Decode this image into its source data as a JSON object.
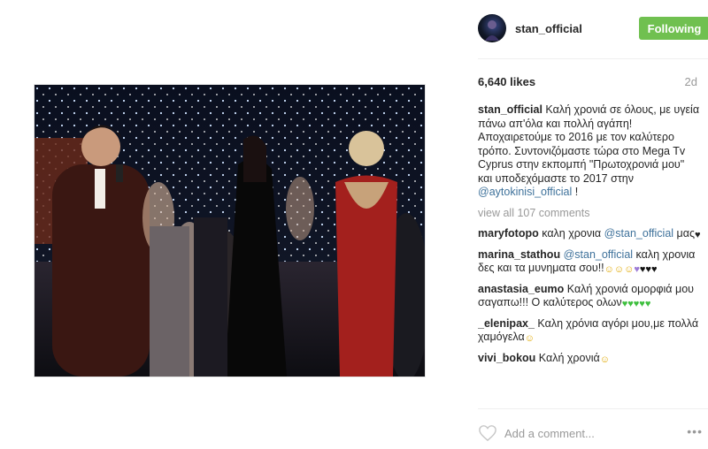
{
  "post": {
    "username": "stan_official",
    "follow_label": "Following",
    "likes": "6,640 likes",
    "age": "2d",
    "view_all": "view all 107 comments",
    "add_comment_placeholder": "Add a comment...",
    "more": "•••",
    "caption": {
      "username": "stan_official",
      "text": "Καλή χρονιά σε όλους, με υγεία πάνω απ'όλα και πολλή αγάπη! Αποχαιρετούμε το 2016 με τον καλύτερο τρόπο. Συντονιζόμαστε τώρα στο Mega Tv Cyprus στην εκπομπή \"Πρωτοχρονιά μου\" και υποδεχόμαστε το 2017 στην ",
      "mention": "@aytokinisi_official",
      "tail": " !"
    },
    "comments": [
      {
        "username": "maryfotopo",
        "text": "καλη χρονια ",
        "mention": "@stan_official",
        "tail": " μας",
        "emojis": [
          "heart-b"
        ]
      },
      {
        "username": "marina_stathou",
        "text": "",
        "mention": "@stan_official",
        "tail": " καλη χρονια δες και τα μυνηματα σου!!",
        "emojis": [
          "face",
          "face",
          "face",
          "heart-p",
          "heart-k",
          "heart-k",
          "heart-k"
        ]
      },
      {
        "username": "anastasia_eumo",
        "text": "Καλή χρονιά ομορφιά μου σαγαπω!!! Ο καλύτερος ολων",
        "mention": "",
        "tail": "",
        "emojis": [
          "heart-g",
          "heart-g",
          "heart-g",
          "heart-g",
          "heart-g"
        ]
      },
      {
        "username": "_elenipax_",
        "text": "Καλη χρόνια αγόρι μου,με πολλά χαμόγελα",
        "mention": "",
        "tail": "",
        "emojis": [
          "face"
        ]
      },
      {
        "username": "vivi_bokou",
        "text": "Καλή χρονιά",
        "mention": "",
        "tail": "",
        "emojis": [
          "face"
        ]
      }
    ]
  },
  "icons": {
    "heart": "heart-outline-icon",
    "heart_glyph": "♥",
    "face_glyph": "☺"
  },
  "colors": {
    "follow_bg": "#70c050",
    "mention": "#3f729b",
    "muted": "#999999"
  }
}
